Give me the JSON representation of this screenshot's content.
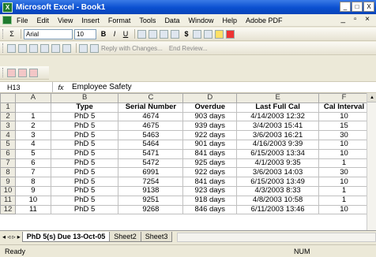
{
  "window": {
    "app_icon": "X",
    "title": "Microsoft Excel - Book1",
    "minimize": "_",
    "maximize": "□",
    "close": "X"
  },
  "menu": {
    "items": [
      "File",
      "Edit",
      "View",
      "Insert",
      "Format",
      "Tools",
      "Data",
      "Window",
      "Help",
      "Adobe PDF"
    ],
    "right": "_ ▫ ×"
  },
  "toolbar": {
    "sigma": "Σ",
    "font_name": "Arial",
    "font_size": "10",
    "bold": "B",
    "italic": "I",
    "underline": "U",
    "currency": "$",
    "reply_with_changes": "Reply with Changes...",
    "end_review": "End Review..."
  },
  "formula_bar": {
    "cell_ref": "H13",
    "fx": "fx",
    "value": "Employee Safety"
  },
  "sheet": {
    "columns": [
      "A",
      "B",
      "C",
      "D",
      "E",
      "F"
    ],
    "selected_column": "G",
    "rows": [
      [
        "",
        "Type",
        "Serial Number",
        "Overdue",
        "Last Full Cal",
        "Cal Interval"
      ],
      [
        "1",
        "PhD 5",
        "4674",
        "903 days",
        "4/14/2003 12:32",
        "10"
      ],
      [
        "2",
        "PhD 5",
        "4675",
        "939 days",
        "3/4/2003 15:41",
        "15"
      ],
      [
        "3",
        "PhD 5",
        "5463",
        "922 days",
        "3/6/2003 16:21",
        "30"
      ],
      [
        "4",
        "PhD 5",
        "5464",
        "901 days",
        "4/16/2003 9:39",
        "10"
      ],
      [
        "5",
        "PhD 5",
        "5471",
        "841 days",
        "6/15/2003 13:34",
        "10"
      ],
      [
        "6",
        "PhD 5",
        "5472",
        "925 days",
        "4/1/2003 9:35",
        "1"
      ],
      [
        "7",
        "PhD 5",
        "6991",
        "922 days",
        "3/6/2003 14:03",
        "30"
      ],
      [
        "8",
        "PhD 5",
        "7254",
        "841 days",
        "6/15/2003 13:49",
        "10"
      ],
      [
        "9",
        "PhD 5",
        "9138",
        "923 days",
        "4/3/2003 8:33",
        "1"
      ],
      [
        "10",
        "PhD 5",
        "9251",
        "918 days",
        "4/8/2003 10:58",
        "1"
      ],
      [
        "11",
        "PhD 5",
        "9268",
        "846 days",
        "6/11/2003 13:46",
        "10"
      ]
    ],
    "row_numbers": [
      "1",
      "2",
      "3",
      "4",
      "5",
      "6",
      "7",
      "8",
      "9",
      "10",
      "11",
      "12"
    ]
  },
  "tabs": {
    "nav": "◂ ◃ ▹ ▸",
    "items": [
      "PhD 5(s) Due 13-Oct-05",
      "Sheet2",
      "Sheet3"
    ],
    "active": "PhD 5(s) Due 13-Oct-05"
  },
  "status": {
    "left": "Ready",
    "num": "NUM"
  }
}
